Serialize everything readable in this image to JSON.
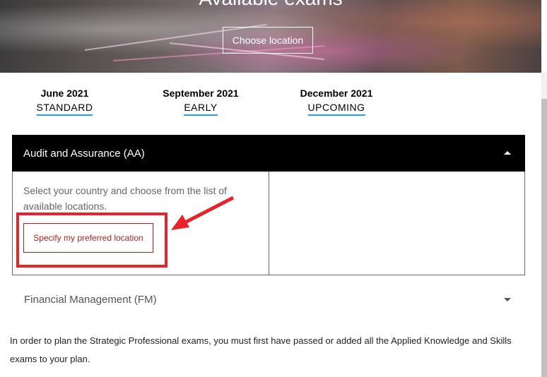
{
  "hero": {
    "title": "Available exams",
    "choose_location": "Choose location"
  },
  "periods": [
    {
      "month": "June 2021",
      "status": "STANDARD"
    },
    {
      "month": "September 2021",
      "status": "EARLY"
    },
    {
      "month": "December 2021",
      "status": "UPCOMING"
    }
  ],
  "exams": [
    {
      "title": "Audit and Assurance (AA)",
      "expanded": true,
      "description": "Select your country and choose from the list of available locations.",
      "action": "Specify my preferred location"
    },
    {
      "title": "Financial Management (FM)",
      "expanded": false
    }
  ],
  "note": "In order to plan the Strategic Professional exams, you must first have passed or added all the Applied Knowledge and Skills exams to your plan.",
  "colors": {
    "accent": "#2aa0d8",
    "action": "#b02020",
    "highlight": "#e8232a",
    "header_bg": "#000000"
  }
}
